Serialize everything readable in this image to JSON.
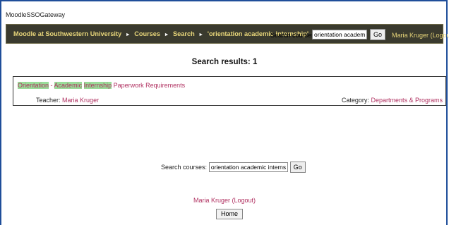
{
  "window": {
    "title": "MoodleSSOGateway"
  },
  "navbar": {
    "breadcrumbs": [
      "Moodle at Southwestern University",
      "Courses",
      "Search",
      "'orientation academic internship'"
    ],
    "separator": "►",
    "search_label": "Search courses:",
    "search_value": "orientation academic",
    "go_label": "Go",
    "user_name": "Maria Kruger",
    "logout_label": "(Logout)"
  },
  "results": {
    "heading": "Search results: 1",
    "course": {
      "title_parts": [
        {
          "text": "Orientation",
          "highlight": true
        },
        {
          "text": " - ",
          "highlight": false
        },
        {
          "text": "Academic",
          "highlight": true
        },
        {
          "text": " ",
          "highlight": false
        },
        {
          "text": "Internship",
          "highlight": true
        },
        {
          "text": " Paperwork Requirements",
          "highlight": false
        }
      ],
      "teacher_label": "Teacher:",
      "teacher_name": "Maria Kruger",
      "category_label": "Category:",
      "category_name": "Departments & Programs"
    }
  },
  "bottom_search": {
    "label": "Search courses:",
    "value": "orientation academic internship",
    "go_label": "Go"
  },
  "footer": {
    "user_name": "Maria Kruger",
    "logout_label": "(Logout)",
    "home_label": "Home"
  },
  "colors": {
    "navbar_bg": "#3a3a2e",
    "navbar_link": "#e8d67a",
    "link": "#b03060",
    "highlight": "#99dd99",
    "frame": "#1f4e9a"
  }
}
